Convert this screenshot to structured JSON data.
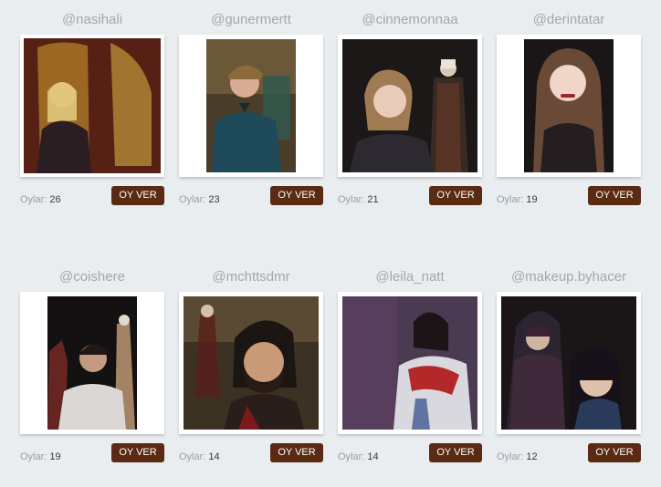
{
  "labels": {
    "votes_label": "Oylar:",
    "vote_button": "OY VER"
  },
  "entries": [
    {
      "username": "@nasihali",
      "votes": "26"
    },
    {
      "username": "@gunermertt",
      "votes": "23"
    },
    {
      "username": "@cinnemonnaa",
      "votes": "21"
    },
    {
      "username": "@derintatar",
      "votes": "19"
    },
    {
      "username": "@coishere",
      "votes": "19"
    },
    {
      "username": "@mchttsdmr",
      "votes": "14"
    },
    {
      "username": "@leila_natt",
      "votes": "14"
    },
    {
      "username": "@makeup.byhacer",
      "votes": "12"
    }
  ],
  "colors": {
    "background": "#e9edf0",
    "button": "#5b2a12",
    "username": "#a4a7ab"
  }
}
